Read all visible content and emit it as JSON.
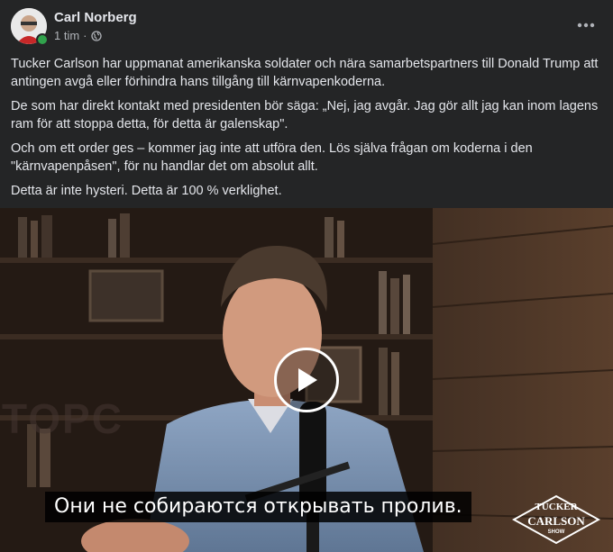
{
  "post": {
    "author": "Carl Norberg",
    "time": "1 tim",
    "separator": "·",
    "audience_icon": "globe-icon",
    "more_icon": "more-dots-icon",
    "paragraphs": [
      "Tucker Carlson har uppmanat amerikanska soldater och nära samarbetspartners till Donald Trump att antingen avgå eller förhindra hans tillgång till kärnvapenkoderna.",
      "De som har direkt kontakt med presidenten bör säga: „Nej, jag avgår. Jag gör allt jag kan inom lagens ram för att stoppa detta, för detta är galenskap\".",
      "Och om ett order ges – kommer jag inte att utföra den. Lös själva frågan om koderna i den \"kärnvapenpåsen\", för nu handlar det om absolut allt.",
      "Detta är inte hysteri. Detta är 100 % verklighet."
    ]
  },
  "video": {
    "subtitle": "Они не собираются открывать пролив.",
    "background_text": "TOPC",
    "logo": {
      "line1": "TUCKER",
      "line2": "CARLSON",
      "line3": "SHOW"
    },
    "play_icon": "play-icon"
  },
  "colors": {
    "background": "#242526",
    "text_primary": "#e4e6eb",
    "text_secondary": "#b0b3b8",
    "online": "#31a24c"
  }
}
